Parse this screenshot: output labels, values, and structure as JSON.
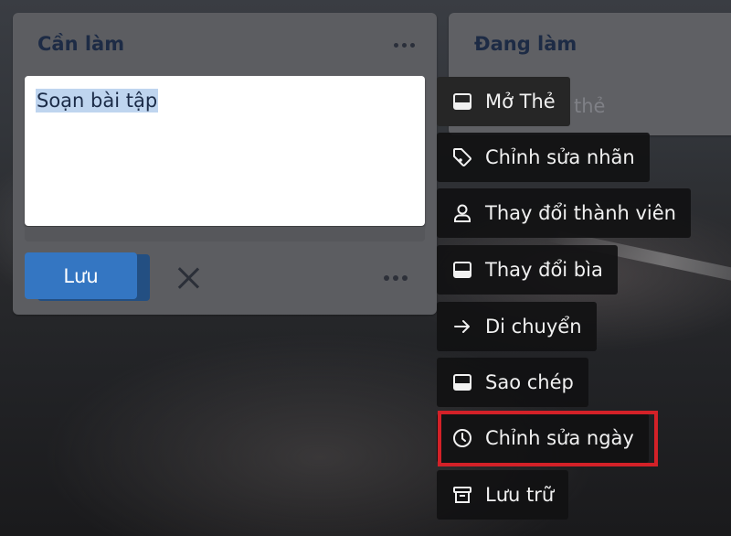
{
  "lists": {
    "todo": {
      "title": "Cần làm",
      "card_text": "Soạn bài tập",
      "save_label": "Lưu"
    },
    "doing": {
      "title": "Đang làm",
      "add_card_partial": "thẻ"
    }
  },
  "menu": {
    "items": [
      {
        "label": "Mở Thẻ",
        "icon": "card-icon"
      },
      {
        "label": "Chỉnh sửa nhãn",
        "icon": "tag-icon"
      },
      {
        "label": "Thay đổi thành viên",
        "icon": "person-icon"
      },
      {
        "label": "Thay đổi bìa",
        "icon": "cover-icon"
      },
      {
        "label": "Di chuyển",
        "icon": "arrow-right-icon"
      },
      {
        "label": "Sao chép",
        "icon": "card-icon"
      },
      {
        "label": "Chỉnh sửa ngày",
        "icon": "clock-icon"
      },
      {
        "label": "Lưu trữ",
        "icon": "archive-icon"
      }
    ]
  },
  "colors": {
    "save_button": "#3476c2",
    "highlight_border": "#d32128",
    "text_selection": "#bfd5ef"
  }
}
